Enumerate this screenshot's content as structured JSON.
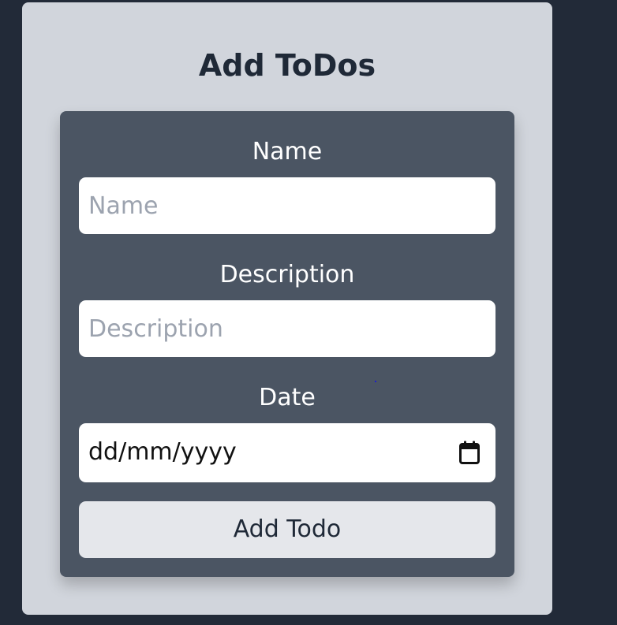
{
  "card": {
    "title": "Add ToDos"
  },
  "form": {
    "name": {
      "label": "Name",
      "placeholder": "Name",
      "value": ""
    },
    "description": {
      "label": "Description",
      "placeholder": "Description",
      "value": ""
    },
    "date": {
      "label": "Date",
      "display": "dd/mm/yyyy",
      "icon": "calendar-icon"
    },
    "submit_label": "Add Todo"
  },
  "colors": {
    "page_background": "#222a38",
    "card_background": "#d1d5dc",
    "form_background": "#4b5563",
    "input_background": "#ffffff",
    "button_background": "#e5e7eb",
    "title_text": "#1f2937",
    "placeholder_text": "#9ca3af"
  }
}
